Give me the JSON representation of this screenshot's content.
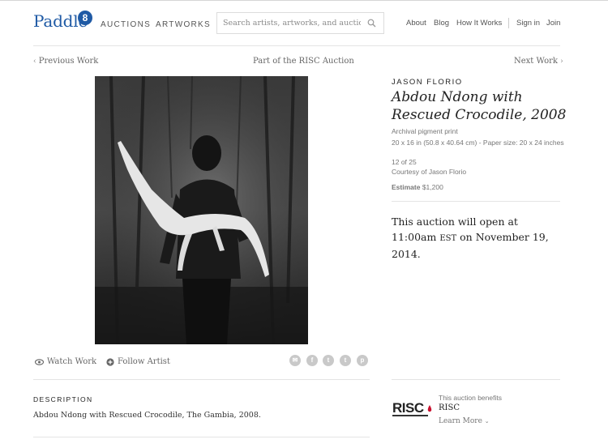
{
  "header": {
    "logo_text": "Paddle",
    "logo_badge": "8",
    "nav": [
      "AUCTIONS",
      "ARTWORKS"
    ],
    "search_placeholder": "Search artists, artworks, and auctions",
    "right_links": [
      "About",
      "Blog",
      "How It Works"
    ],
    "account_links": [
      "Sign in",
      "Join"
    ]
  },
  "breadcrumb": {
    "previous": "Previous Work",
    "auction": "Part of the RISC Auction",
    "next": "Next Work"
  },
  "artwork": {
    "artist": "JASON FLORIO",
    "title": "Abdou Ndong with Rescued Crocodile, 2008",
    "medium": "Archival pigment print",
    "dimensions": "20 x 16 in (50.8 x 40.64 cm) - Paper size: 20 x 24 inches",
    "edition": "12 of 25",
    "courtesy": "Courtesy of Jason Florio",
    "estimate_label": "Estimate",
    "estimate_value": "$1,200"
  },
  "auction_notice": {
    "line1": "This auction will open at",
    "time": "11:00am",
    "zone": "EST",
    "rest": "on November 19, 2014."
  },
  "actions": {
    "watch": "Watch Work",
    "follow": "Follow Artist"
  },
  "share_icons": [
    "email-icon",
    "facebook-icon",
    "tumblr-icon",
    "twitter-icon",
    "pinterest-icon"
  ],
  "description": {
    "heading": "DESCRIPTION",
    "text": "Abdou Ndong with Rescued Crocodile, The Gambia, 2008."
  },
  "benefit": {
    "label": "This auction benefits",
    "org": "RISC",
    "learn_more": "Learn More",
    "logo_text": "RISC"
  },
  "colors": {
    "brand": "#1f5aa5",
    "risc_red": "#c8102e",
    "share_icon": "#c9c9c9"
  }
}
